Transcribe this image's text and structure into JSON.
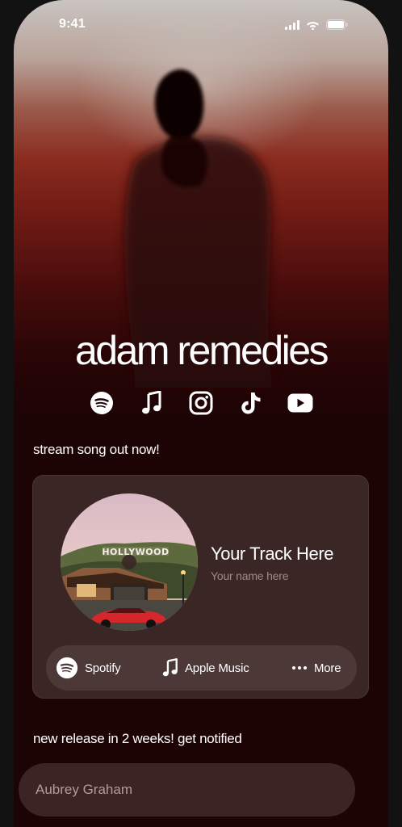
{
  "status_bar": {
    "time": "9:41"
  },
  "profile": {
    "artist_name": "adam remedies"
  },
  "socials": [
    {
      "icon": "spotify-icon"
    },
    {
      "icon": "music-note-icon"
    },
    {
      "icon": "instagram-icon"
    },
    {
      "icon": "tiktok-icon"
    },
    {
      "icon": "youtube-icon"
    }
  ],
  "featured": {
    "heading": "stream song out now!",
    "track_title": "Your Track Here",
    "track_artist": "Your name here",
    "platforms": [
      {
        "label": "Spotify",
        "icon": "spotify-icon"
      },
      {
        "label": "Apple Music",
        "icon": "music-note-icon"
      },
      {
        "label": "More",
        "icon": "more-dots-icon"
      }
    ]
  },
  "notify": {
    "heading": "new release in 2 weeks! get notified",
    "input_placeholder": "Aubrey Graham"
  },
  "colors": {
    "background": "#1c0405",
    "card": "#3b2626",
    "pill": "#4d3838",
    "input": "#3d2424",
    "muted_text": "#9d8b8a"
  }
}
